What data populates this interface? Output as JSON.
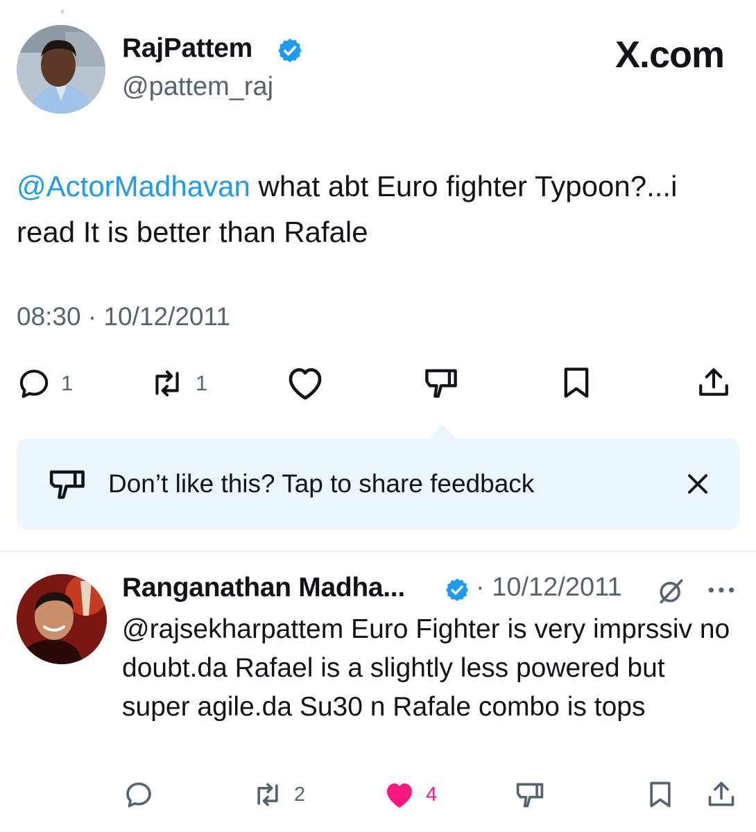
{
  "brand": "X.com",
  "tweet": {
    "author_name": "RajPattem",
    "author_handle": "@pattem_raj",
    "mention": "@ActorMadhavan",
    "text": " what abt Euro fighter Typoon?...i read It is better than Rafale",
    "timestamp": "08:30 · 10/12/2011",
    "actions": {
      "reply_count": "1",
      "repost_count": "1"
    }
  },
  "feedback": {
    "text": "Don’t like this? Tap to share feedback"
  },
  "reply": {
    "author_name": "Ranganathan Madha...",
    "date": "· 10/12/2011",
    "text": "@rajsekharpattem Euro Fighter is very imprssiv no doubt.da Rafael is a slightly less powered but super agile.da Su30 n Rafale combo is tops",
    "actions": {
      "repost_count": "2",
      "like_count": "4"
    }
  },
  "colors": {
    "accent": "#1d9bf0",
    "secondary_text": "#536471",
    "like_pink": "#f91880",
    "feedback_bg": "#eaf6fb"
  },
  "icons": [
    "verified-badge-icon",
    "reply-icon",
    "repost-icon",
    "like-icon",
    "dislike-icon",
    "bookmark-icon",
    "share-icon",
    "close-icon",
    "grok-icon",
    "more-icon"
  ]
}
